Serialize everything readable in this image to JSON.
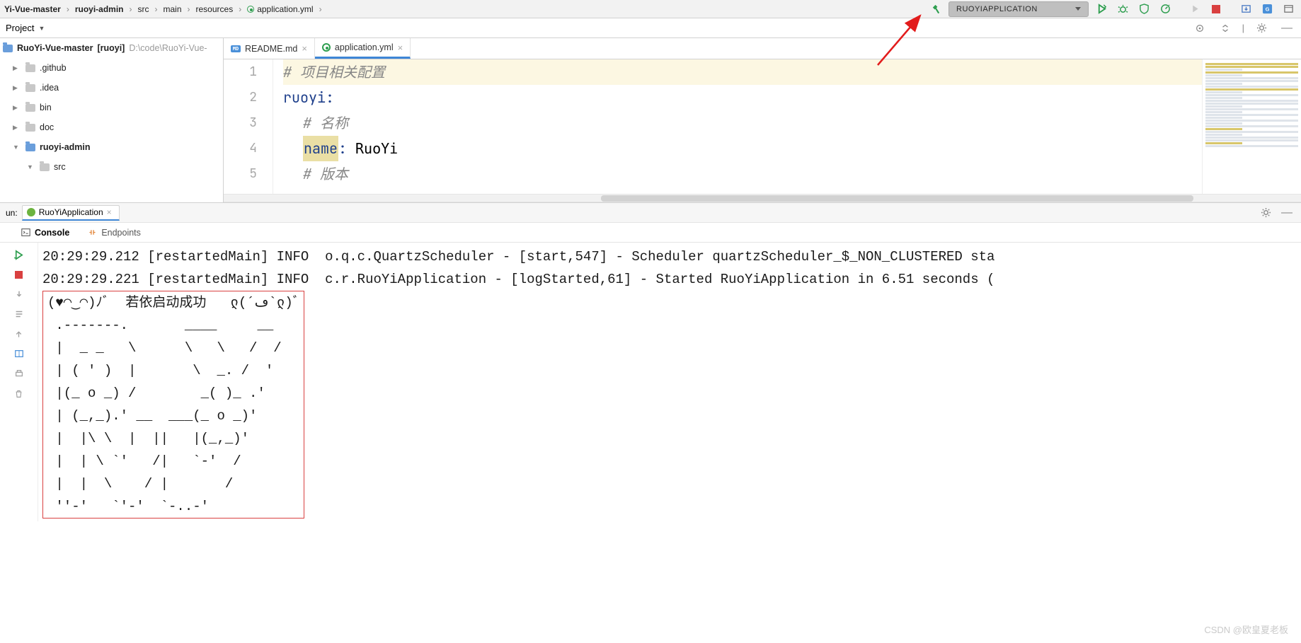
{
  "breadcrumbs": {
    "c0": "Yi-Vue-master",
    "c1": "ruoyi-admin",
    "c2": "src",
    "c3": "main",
    "c4": "resources",
    "c5": "application.yml"
  },
  "run_config": {
    "label": "RUOYIAPPLICATION"
  },
  "project_view": {
    "label": "Project"
  },
  "tree": {
    "root_name": "RuoYi-Vue-master",
    "root_scope": "[ruoyi]",
    "root_path": "D:\\code\\RuoYi-Vue-",
    "github": ".github",
    "idea": ".idea",
    "bin": "bin",
    "doc": "doc",
    "admin": "ruoyi-admin",
    "src": "src"
  },
  "tabs": {
    "readme": "README.md",
    "yml": "application.yml"
  },
  "editor": {
    "l1_comment": "# 项目相关配置",
    "l2_key": "ruoyi",
    "l3_comment": "# 名称",
    "l4_key": "name",
    "l4_val": "RuoYi",
    "l5_comment": "# 版本",
    "ln1": "1",
    "ln2": "2",
    "ln3": "3",
    "ln4": "4",
    "ln5": "5"
  },
  "run_label": "un:",
  "run_tab": "RuoYiApplication",
  "subtabs": {
    "console": "Console",
    "endpoints": "Endpoints"
  },
  "console": {
    "line1": "20:29:29.212 [restartedMain] INFO  o.q.c.QuartzScheduler - [start,547] - Scheduler quartzScheduler_$_NON_CLUSTERED sta",
    "line2": "20:29:29.221 [restartedMain] INFO  c.r.RuoYiApplication - [logStarted,61] - Started RuoYiApplication in 6.51 seconds (",
    "success_emoji": "(♥◠‿◠)ﾉﾞ  若依启动成功   ლ(´ڡ`ლ)ﾞ",
    "art1": " .-------.       ____     __",
    "art2": " |  _ _   \\      \\   \\   /  /",
    "art3": " | ( ' )  |       \\  _. /  '",
    "art4": " |(_ o _) /        _( )_ .'",
    "art5": " | (_,_).' __  ___(_ o _)'",
    "art6": " |  |\\ \\  |  ||   |(_,_)'",
    "art7": " |  | \\ `'   /|   `-'  /",
    "art8": " |  |  \\    / |       /",
    "art9": " ''-'   `'-'  `-..-'"
  },
  "watermark": "CSDN @欧皇夏老板"
}
